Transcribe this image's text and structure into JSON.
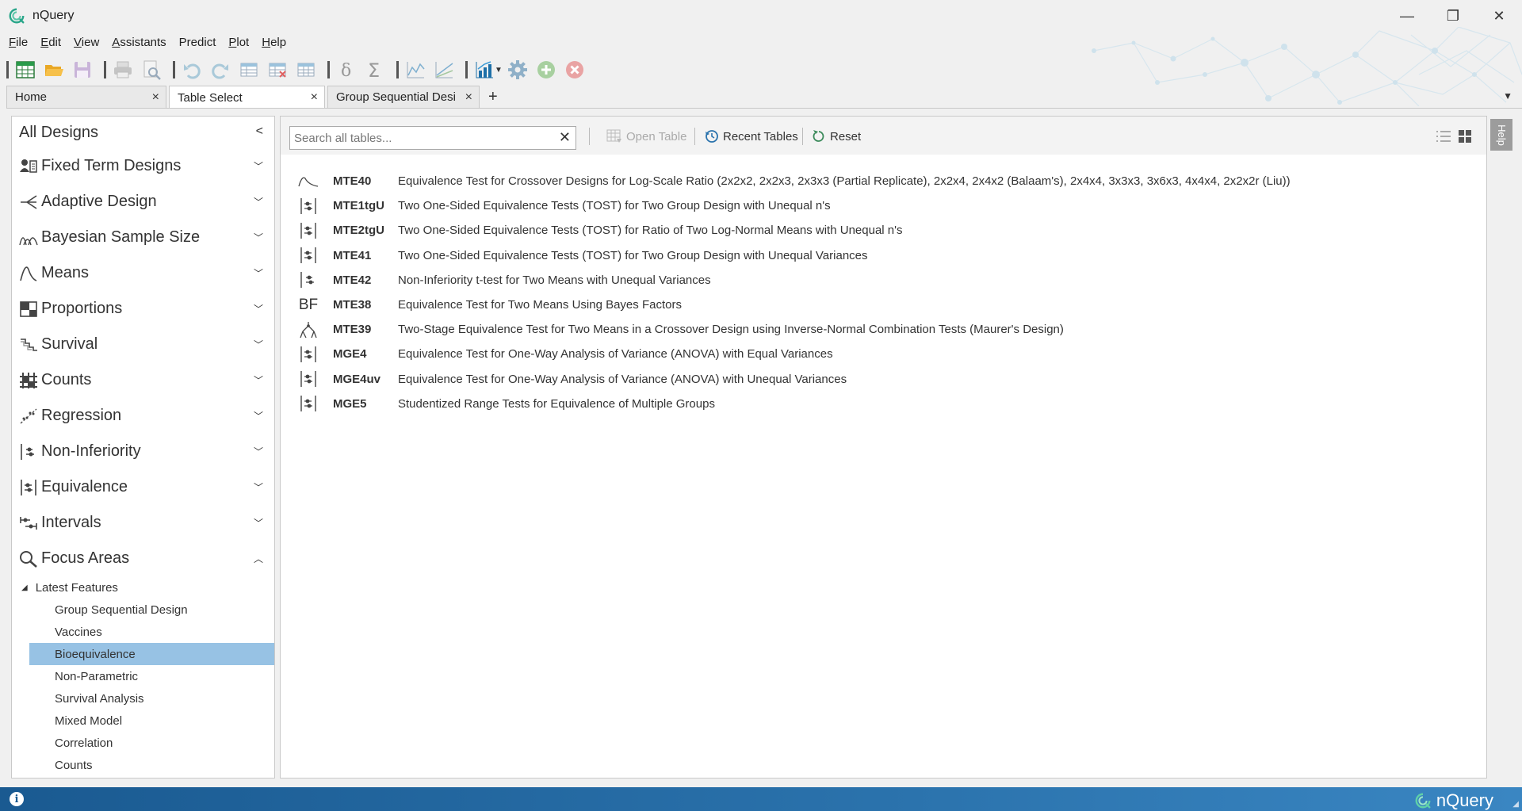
{
  "window": {
    "title": "nQuery",
    "minimize": "—",
    "restore": "❐",
    "close": "✕"
  },
  "menu": [
    {
      "label": "File",
      "key": "F",
      "rest": "ile"
    },
    {
      "label": "Edit",
      "key": "E",
      "rest": "dit"
    },
    {
      "label": "View",
      "key": "V",
      "rest": "iew"
    },
    {
      "label": "Assistants",
      "key": "A",
      "rest": "ssistants"
    },
    {
      "label": "Predict",
      "key": "",
      "rest": "Predict"
    },
    {
      "label": "Plot",
      "key": "P",
      "rest": "lot"
    },
    {
      "label": "Help",
      "key": "H",
      "rest": "elp"
    }
  ],
  "toolbar": {
    "icons": [
      "new-table-icon",
      "open-folder-icon",
      "save-icon",
      "print-icon",
      "print-preview-icon",
      "undo-icon",
      "redo-icon",
      "insert-rows-icon",
      "delete-rows-icon",
      "table-options-icon",
      "delta-icon",
      "sigma-icon",
      "line-plot-icon",
      "scatter-plot-icon",
      "bar-chart-icon",
      "settings-gear-icon",
      "add-icon",
      "cancel-icon"
    ]
  },
  "tabs": [
    {
      "label": "Home",
      "close": "×",
      "active": false
    },
    {
      "label": "Table Select",
      "close": "×",
      "active": true
    },
    {
      "label": "Group Sequential Desi",
      "close": "×",
      "active": false
    }
  ],
  "tab_add": "+",
  "tabs_menu": "▼",
  "sidebar": {
    "header": "All Designs",
    "header_chevron": "<",
    "categories": [
      {
        "label": "Fixed Term Designs",
        "icon": "fixed-term-icon"
      },
      {
        "label": "Adaptive Design",
        "icon": "adaptive-icon"
      },
      {
        "label": "Bayesian Sample Size",
        "icon": "bayesian-icon"
      },
      {
        "label": "Means",
        "icon": "means-icon"
      },
      {
        "label": "Proportions",
        "icon": "proportions-icon"
      },
      {
        "label": "Survival",
        "icon": "survival-icon"
      },
      {
        "label": "Counts",
        "icon": "counts-icon"
      },
      {
        "label": "Regression",
        "icon": "regression-icon"
      },
      {
        "label": "Non-Inferiority",
        "icon": "non-inferiority-icon"
      },
      {
        "label": "Equivalence",
        "icon": "equivalence-icon"
      },
      {
        "label": "Intervals",
        "icon": "intervals-icon"
      },
      {
        "label": "Focus Areas",
        "icon": "magnifier-icon"
      }
    ],
    "tree_parent": "Latest Features",
    "tree_items": [
      "Group Sequential Design",
      "Vaccines",
      "Bioequivalence",
      "Non-Parametric",
      "Survival Analysis",
      "Mixed Model",
      "Correlation",
      "Counts"
    ],
    "selected_item": "Bioequivalence"
  },
  "main_toolbar": {
    "search_placeholder": "Search all tables...",
    "search_value": "",
    "clear": "✕",
    "open_table": "Open Table",
    "recent_tables": "Recent Tables",
    "reset": "Reset"
  },
  "tables": [
    {
      "icon": "crossover-curve-icon",
      "code": "MTE40",
      "title": "Equivalence Test for Crossover Designs for Log-Scale Ratio (2x2x2, 2x2x3, 2x3x3 (Partial Replicate), 2x2x4, 2x4x2 (Balaam's), 2x4x4, 3x3x3, 3x6x3, 4x4x4, 2x2x2r (Liu))"
    },
    {
      "icon": "equivalence-icon",
      "code": "MTE1tgU",
      "title": "Two One-Sided Equivalence Tests (TOST) for Two Group Design with Unequal n's"
    },
    {
      "icon": "equivalence-icon",
      "code": "MTE2tgU",
      "title": "Two One-Sided Equivalence Tests (TOST) for Ratio of Two Log-Normal Means with Unequal n's"
    },
    {
      "icon": "equivalence-icon",
      "code": "MTE41",
      "title": "Two One-Sided Equivalence Tests (TOST) for Two Group Design with Unequal Variances"
    },
    {
      "icon": "non-inferiority-icon",
      "code": "MTE42",
      "title": "Non-Inferiority t-test for Two Means with Unequal Variances"
    },
    {
      "icon": "bayes-factor-icon",
      "code": "MTE38",
      "title": "Equivalence Test for Two Means Using Bayes Factors",
      "icon_text": "BF"
    },
    {
      "icon": "adaptive-tree-icon",
      "code": "MTE39",
      "title": "Two-Stage Equivalence Test for Two Means in a Crossover Design using Inverse-Normal Combination Tests (Maurer's Design)"
    },
    {
      "icon": "equivalence-icon",
      "code": "MGE4",
      "title": "Equivalence Test for One-Way Analysis of Variance (ANOVA) with Equal Variances"
    },
    {
      "icon": "equivalence-icon",
      "code": "MGE4uv",
      "title": "Equivalence Test for One-Way Analysis of Variance (ANOVA) with Unequal Variances"
    },
    {
      "icon": "equivalence-icon",
      "code": "MGE5",
      "title": "Studentized Range Tests for Equivalence of Multiple Groups"
    }
  ],
  "help_tab": "Help",
  "status": {
    "info": "i",
    "brand": "nQuery"
  },
  "colors": {
    "accent": "#2b73ad",
    "selected": "#97c2e4",
    "status_bar": "#1a5a91"
  }
}
